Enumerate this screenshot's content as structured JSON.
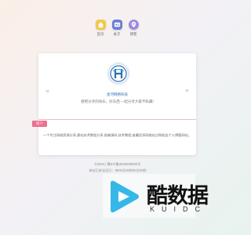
{
  "nav": {
    "items": [
      {
        "label": "首页",
        "icon": "home-icon",
        "color": "#f4c84d"
      },
      {
        "label": "关于",
        "icon": "id-card-icon",
        "color": "#6b7fd6"
      },
      {
        "label": "博客",
        "icon": "location-pin-icon",
        "color": "#9b8ce0"
      }
    ]
  },
  "profile": {
    "site_name": "星河网络科技",
    "tagline": "愿把分享的快乐，好东西 一起分享大家不私藏!",
    "tag_label": "简介",
    "intro": "一个专注网络资源分享,建站技术教程分享,前端源码,技术教程,收藏优质网络站点帮助这个人博客网站。"
  },
  "footer": {
    "icp": "©2024 | 豫ICP备2023000000号",
    "runtime": "本站已安全运行：0000天00时00分00秒"
  },
  "watermark": {
    "brand": "酷数据",
    "sub": "KUIDC"
  },
  "colors": {
    "accent_pink": "#ec6f8f",
    "link_blue": "#2f6fb5"
  }
}
